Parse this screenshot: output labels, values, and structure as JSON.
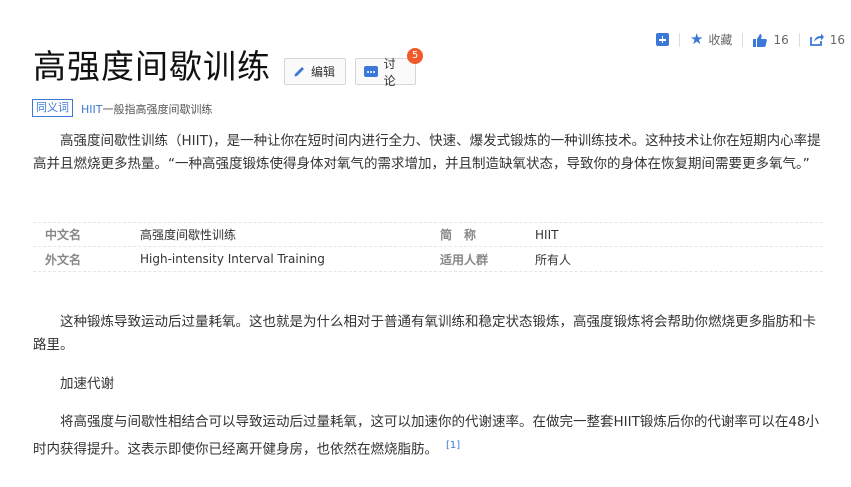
{
  "toolbar": {
    "collect_label": "收藏",
    "like_count": "16",
    "share_count": "16"
  },
  "title": "高强度间歇训练",
  "buttons": {
    "edit_label": "编辑",
    "discuss_label": "讨论",
    "discuss_badge": "5"
  },
  "synonym": {
    "tag": "同义词",
    "term": "HIIT",
    "text": "一般指高强度间歇训练"
  },
  "paragraphs": {
    "intro": "高强度间歇性训练（HIIT)，是一种让你在短时间内进行全力、快速、爆发式锻炼的一种训练技术。这种技术让你在短期内心率提高并且燃烧更多热量。“一种高强度锻炼使得身体对氧气的需求增加，并且制造缺氧状态，导致你的身体在恢复期间需要更多氧气。”",
    "afterburn": "这种锻炼导致运动后过量耗氧。这也就是为什么相对于普通有氧训练和稳定状态锻炼，高强度锻炼将会帮助你燃烧更多脂肪和卡路里。",
    "section_heading": "加速代谢",
    "metabolism": "将高强度与间歇性相结合可以导致运动后过量耗氧，这可以加速你的代谢速率。在做完一整套HIIT锻炼后你的代谢率可以在48小时内获得提升。这表示即使你已经离开健身房，也依然在燃烧脂肪。",
    "ref": "[1]"
  },
  "info": [
    {
      "k1": "中文名",
      "v1": "高强度间歇性训练",
      "k2": "简　称",
      "v2": "HIIT"
    },
    {
      "k1": "外文名",
      "v1": "High-intensity Interval Training",
      "k2": "适用人群",
      "v2": "所有人"
    }
  ],
  "colors": {
    "accent": "#3b78d8",
    "badge": "#f05a2a"
  }
}
